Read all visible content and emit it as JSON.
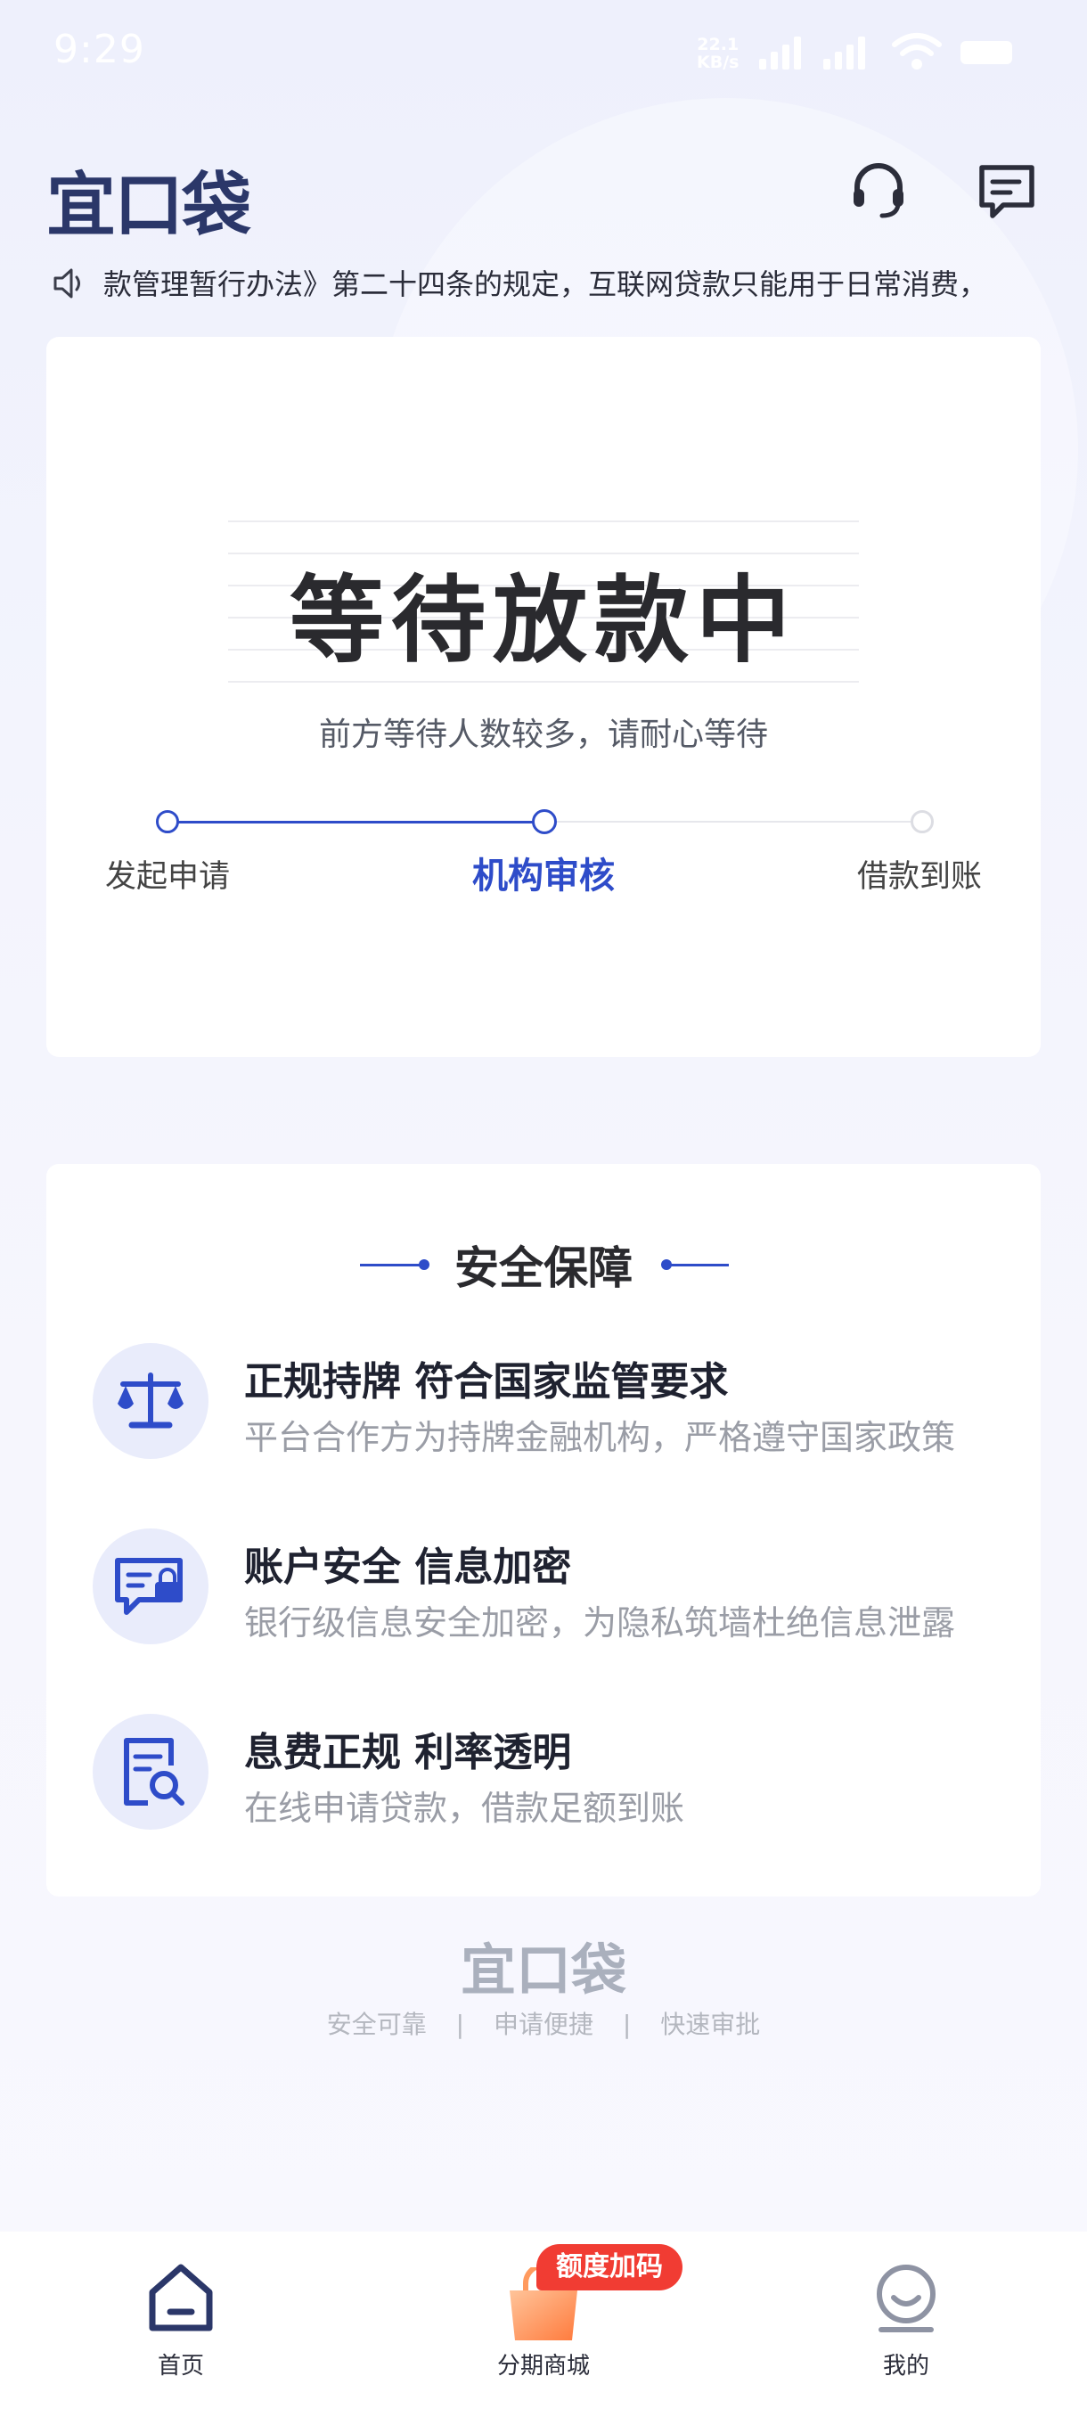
{
  "status_bar": {
    "time": "9:29",
    "net_speed_value": "22.1",
    "net_speed_unit": "KB/s"
  },
  "header": {
    "logo": "宜口袋",
    "icons": [
      "headset-icon",
      "message-icon"
    ]
  },
  "notice": {
    "text": "款管理暂行办法》第二十四条的规定，互联网贷款只能用于日常消费，"
  },
  "loan_status": {
    "title": "等待放款中",
    "subtitle": "前方等待人数较多，请耐心等待",
    "steps": [
      "发起申请",
      "机构审核",
      "借款到账"
    ],
    "current_step": 2
  },
  "security": {
    "title": "安全保障",
    "features": [
      {
        "icon": "scale-icon",
        "title": "正规持牌 符合国家监管要求",
        "desc": "平台合作方为持牌金融机构，严格遵守国家政策"
      },
      {
        "icon": "secure-message-icon",
        "title": "账户安全 信息加密",
        "desc": "银行级信息安全加密，为隐私筑墙杜绝信息泄露"
      },
      {
        "icon": "document-search-icon",
        "title": "息费正规  利率透明",
        "desc": "在线申请贷款，借款足额到账"
      }
    ]
  },
  "footer": {
    "logo": "宜口袋",
    "taglines": [
      "安全可靠",
      "申请便捷",
      "快速审批"
    ],
    "separator": "|"
  },
  "bottom_nav": {
    "items": [
      {
        "label": "首页",
        "icon": "home-icon"
      },
      {
        "label": "分期商城",
        "icon": "shopping-bag-icon"
      },
      {
        "label": "我的",
        "icon": "profile-icon"
      }
    ],
    "badge": "额度加码"
  },
  "colors": {
    "accent": "#2e4cc9",
    "brand_dark": "#2b3769",
    "badge_red": "#f13c33"
  }
}
